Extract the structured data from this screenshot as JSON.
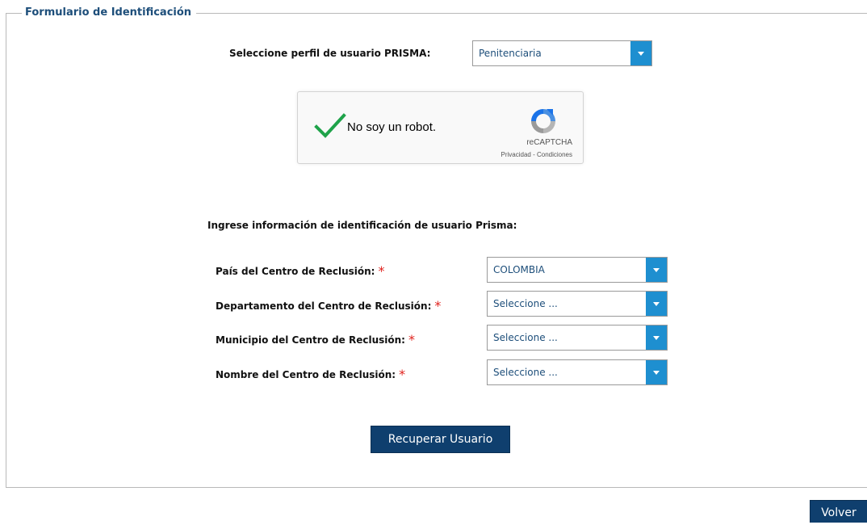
{
  "form": {
    "legend": "Formulario de Identificación",
    "profile_label": "Seleccione perfil de usuario PRISMA:",
    "profile_value": "Penitenciaria",
    "captcha": {
      "label": "No soy un robot.",
      "brand": "reCAPTCHA",
      "terms": "Privacidad - Condiciones"
    },
    "section_title": "Ingrese información de identificación de usuario Prisma:",
    "fields": [
      {
        "label": "País del Centro de Reclusión:",
        "value": "COLOMBIA"
      },
      {
        "label": "Departamento del Centro de Reclusión:",
        "value": "Seleccione ..."
      },
      {
        "label": "Municipio del Centro de Reclusión:",
        "value": "Seleccione ..."
      },
      {
        "label": "Nombre del Centro de Reclusión:",
        "value": "Seleccione ..."
      }
    ],
    "required_mark": "*",
    "submit_label": "Recuperar Usuario"
  },
  "back_label": "Volver",
  "colors": {
    "legend": "#1d4e7a",
    "dropdown_arrow": "#1e8fd0",
    "button": "#0f3f6e",
    "required": "#e0221d",
    "checkmark": "#1fa34a"
  },
  "icons": [
    "checkmark-icon",
    "recaptcha-logo-icon",
    "chevron-down-icon"
  ]
}
